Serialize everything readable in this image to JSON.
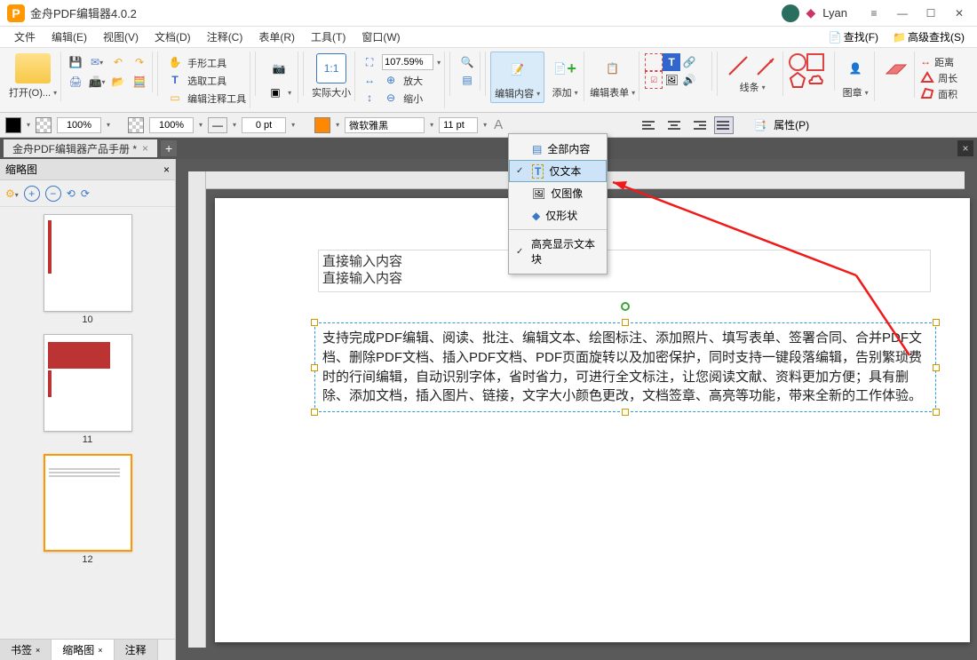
{
  "app": {
    "title": "金舟PDF编辑器4.0.2",
    "user": "Lyan"
  },
  "menu": {
    "items": [
      "文件",
      "编辑(E)",
      "视图(V)",
      "文档(D)",
      "注释(C)",
      "表单(R)",
      "工具(T)",
      "窗口(W)"
    ],
    "find": "查找(F)",
    "adv_find": "高级查找(S)"
  },
  "toolbar": {
    "open": "打开(O)...",
    "hand_tool": "手形工具",
    "select_tool": "选取工具",
    "edit_annot_tool": "编辑注释工具",
    "actual_size": "实际大小",
    "zoom_value": "107.59%",
    "zoom_in": "放大",
    "zoom_out": "缩小",
    "edit_content": "编辑内容",
    "add": "添加",
    "edit_form": "编辑表单",
    "lines": "线条",
    "stamp": "图章",
    "distance": "距离",
    "perimeter": "周长",
    "area": "面积"
  },
  "propbar": {
    "opacity": "100%",
    "stroke_opacity": "100%",
    "stroke_w": "0 pt",
    "font": "微软雅黑",
    "font_size": "11 pt",
    "props": "属性(P)"
  },
  "doc_tab": "金舟PDF编辑器产品手册 *",
  "side": {
    "title": "缩略图",
    "pages": [
      "10",
      "11",
      "12"
    ],
    "tabs": [
      "书签",
      "缩略图",
      "注释"
    ]
  },
  "dropdown": {
    "all": "全部内容",
    "text_only": "仅文本",
    "image_only": "仅图像",
    "shape_only": "仅形状",
    "highlight": "高亮显示文本块"
  },
  "page_content": {
    "line1": "直接输入内容",
    "line2": "直接输入内容",
    "para": "支持完成PDF编辑、阅读、批注、编辑文本、绘图标注、添加照片、填写表单、签署合同、合并PDF文档、删除PDF文档、插入PDF文档、PDF页面旋转以及加密保护，同时支持一键段落编辑，告别繁琐费时的行间编辑，自动识别字体，省时省力，可进行全文标注，让您阅读文献、资料更加方便；具有删除、添加文档，插入图片、链接，文字大小颜色更改，文档签章、高亮等功能，带来全新的工作体验。"
  }
}
